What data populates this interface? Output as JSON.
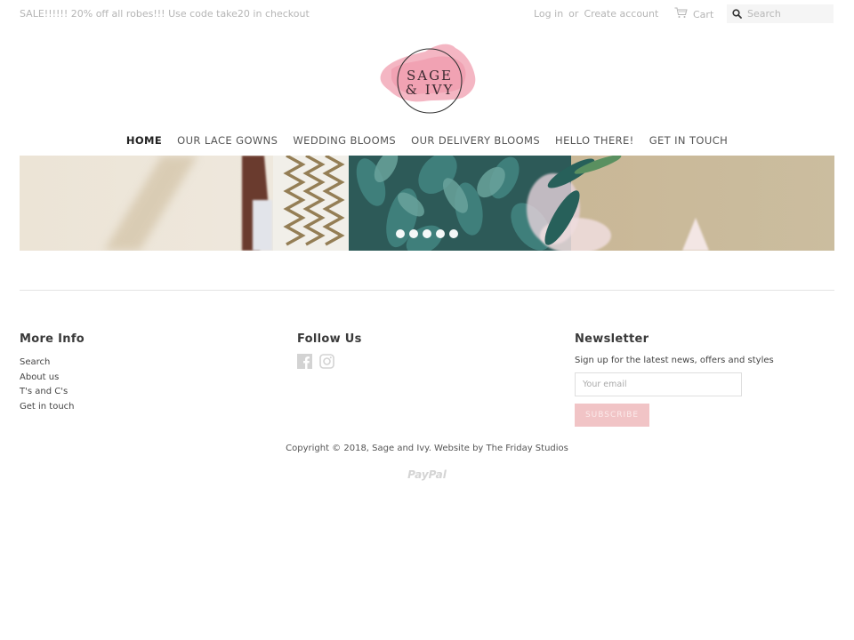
{
  "topbar": {
    "promo": "SALE!!!!!! 20% off all robes!!! Use code take20 in checkout",
    "login": "Log in",
    "or": "or",
    "create_account": "Create account",
    "cart": "Cart",
    "search_placeholder": "Search"
  },
  "logo": {
    "line1": "SAGE",
    "line2": "& IVY",
    "accent": "#f0a3b6"
  },
  "nav": {
    "items": [
      {
        "label": "HOME",
        "active": true
      },
      {
        "label": "OUR LACE GOWNS",
        "active": false
      },
      {
        "label": "WEDDING BLOOMS",
        "active": false
      },
      {
        "label": "OUR DELIVERY BLOOMS",
        "active": false
      },
      {
        "label": "HELLO THERE!",
        "active": false
      },
      {
        "label": "GET IN TOUCH",
        "active": false
      }
    ]
  },
  "hero": {
    "slide_count": 5
  },
  "footer": {
    "more_info": {
      "title": "More Info",
      "links": [
        "Search",
        "About us",
        "T's and C's",
        "Get in touch"
      ]
    },
    "follow_us": {
      "title": "Follow Us",
      "icons": [
        "facebook-icon",
        "instagram-icon"
      ]
    },
    "newsletter": {
      "title": "Newsletter",
      "text": "Sign up for the latest news, offers and styles",
      "email_placeholder": "Your email",
      "subscribe_label": "SUBSCRIBE",
      "button_color": "#f1c4c6"
    },
    "copyright_prefix": "Copyright © 2018, ",
    "copyright_brand": "Sage and Ivy",
    "copyright_middle": ". Website by ",
    "copyright_studio": "The Friday Studios",
    "payment": "PayPal"
  }
}
